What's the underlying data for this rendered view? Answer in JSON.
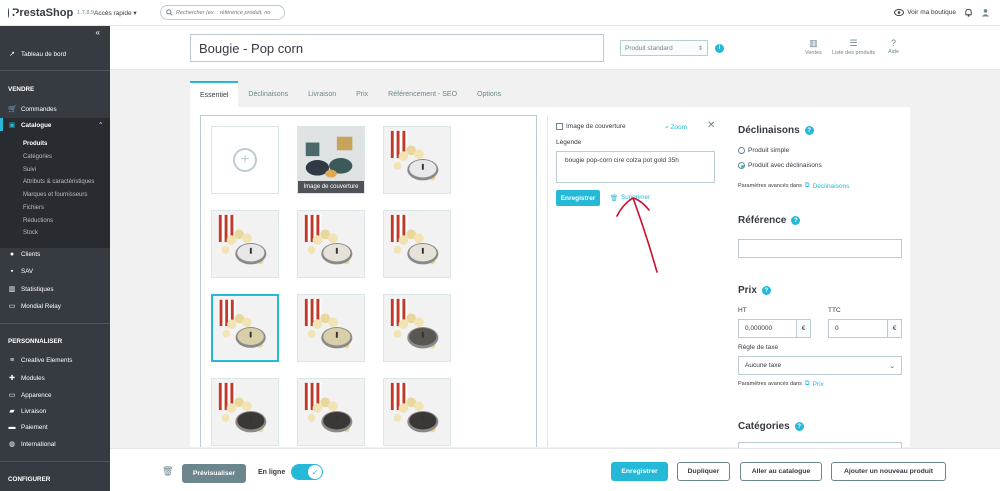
{
  "topbar": {
    "brand": "PrestaShop",
    "version": "1.7.8.9",
    "quick_access": "Accès rapide",
    "search_placeholder": "Rechercher (ex. : référence produit, no",
    "view_shop": "Voir ma boutique"
  },
  "sidebar": {
    "dashboard": "Tableau de bord",
    "sections": {
      "sell": "VENDRE",
      "personalize": "PERSONNALISER",
      "configure": "CONFIGURER"
    },
    "sell_items": [
      "Commandes",
      "Catalogue"
    ],
    "catalog_sub": [
      "Produits",
      "Catégories",
      "Suivi",
      "Attributs & caractéristiques",
      "Marques et fournisseurs",
      "Fichiers",
      "Réductions",
      "Stock"
    ],
    "sell_items2": [
      "Clients",
      "SAV",
      "Statistiques",
      "Mondial Relay"
    ],
    "personalize_items": [
      "Creative Elements",
      "Modules",
      "Apparence",
      "Livraison",
      "Paiement",
      "International"
    ]
  },
  "header": {
    "product_name": "Bougie - Pop corn",
    "product_type": "Produit standard",
    "actions": [
      "Ventes",
      "Liste des produits",
      "Aide"
    ]
  },
  "tabs": [
    "Essentiel",
    "Déclinaisons",
    "Livraison",
    "Prix",
    "Référencement - SEO",
    "Options"
  ],
  "gallery": {
    "cover_label": "Image de couverture"
  },
  "image_editor": {
    "cover_checkbox": "Image de couverture",
    "zoom": "Zoom",
    "legend_label": "Légende",
    "legend_value": "bougie pop-corn cire colza pot gold 35h",
    "save": "Enregistrer",
    "delete": "Supprimer"
  },
  "right": {
    "declinaisons_title": "Déclinaisons",
    "radio_simple": "Produit simple",
    "radio_variants": "Produit avec déclinaisons",
    "adv_params": "Paramètres avancés dans",
    "adv_link_decl": "Déclinaisons",
    "reference_title": "Référence",
    "reference_value": "",
    "price_title": "Prix",
    "ht_label": "HT",
    "ttc_label": "TTC",
    "ht_value": "0,000000",
    "ttc_value": "0",
    "currency": "€",
    "tax_rule_label": "Règle de taxe",
    "tax_rule_value": "Aucune taxe",
    "adv_link_price": "Prix",
    "categories_title": "Catégories"
  },
  "footer": {
    "preview": "Prévisualiser",
    "online": "En ligne",
    "save": "Enregistrer",
    "duplicate": "Dupliquer",
    "goto_catalog": "Aller au catalogue",
    "add_new": "Ajouter un nouveau produit"
  },
  "colors": {
    "accent": "#25b9d7",
    "sidebar": "#363a41",
    "annotation": "#c8102e"
  },
  "product_images": [
    {
      "scene": "cover",
      "lid": "#2f3a44"
    },
    {
      "scene": "popcorn-box",
      "lid": "#e8e8ea"
    },
    {
      "scene": "popcorn-box",
      "lid": "#e8e8ea"
    },
    {
      "scene": "popcorn-box",
      "lid": "#e6e2da"
    },
    {
      "scene": "popcorn-box",
      "lid": "#e6e2da"
    },
    {
      "scene": "popcorn-box",
      "lid": "#d8cfa8"
    },
    {
      "scene": "popcorn-box",
      "lid": "#d8cfa8"
    },
    {
      "scene": "popcorn-box",
      "lid": "#5a5650"
    },
    {
      "scene": "popcorn-box",
      "lid": "#3a3836"
    },
    {
      "scene": "popcorn-box",
      "lid": "#3a3836"
    },
    {
      "scene": "popcorn-box",
      "lid": "#3a3836"
    }
  ]
}
